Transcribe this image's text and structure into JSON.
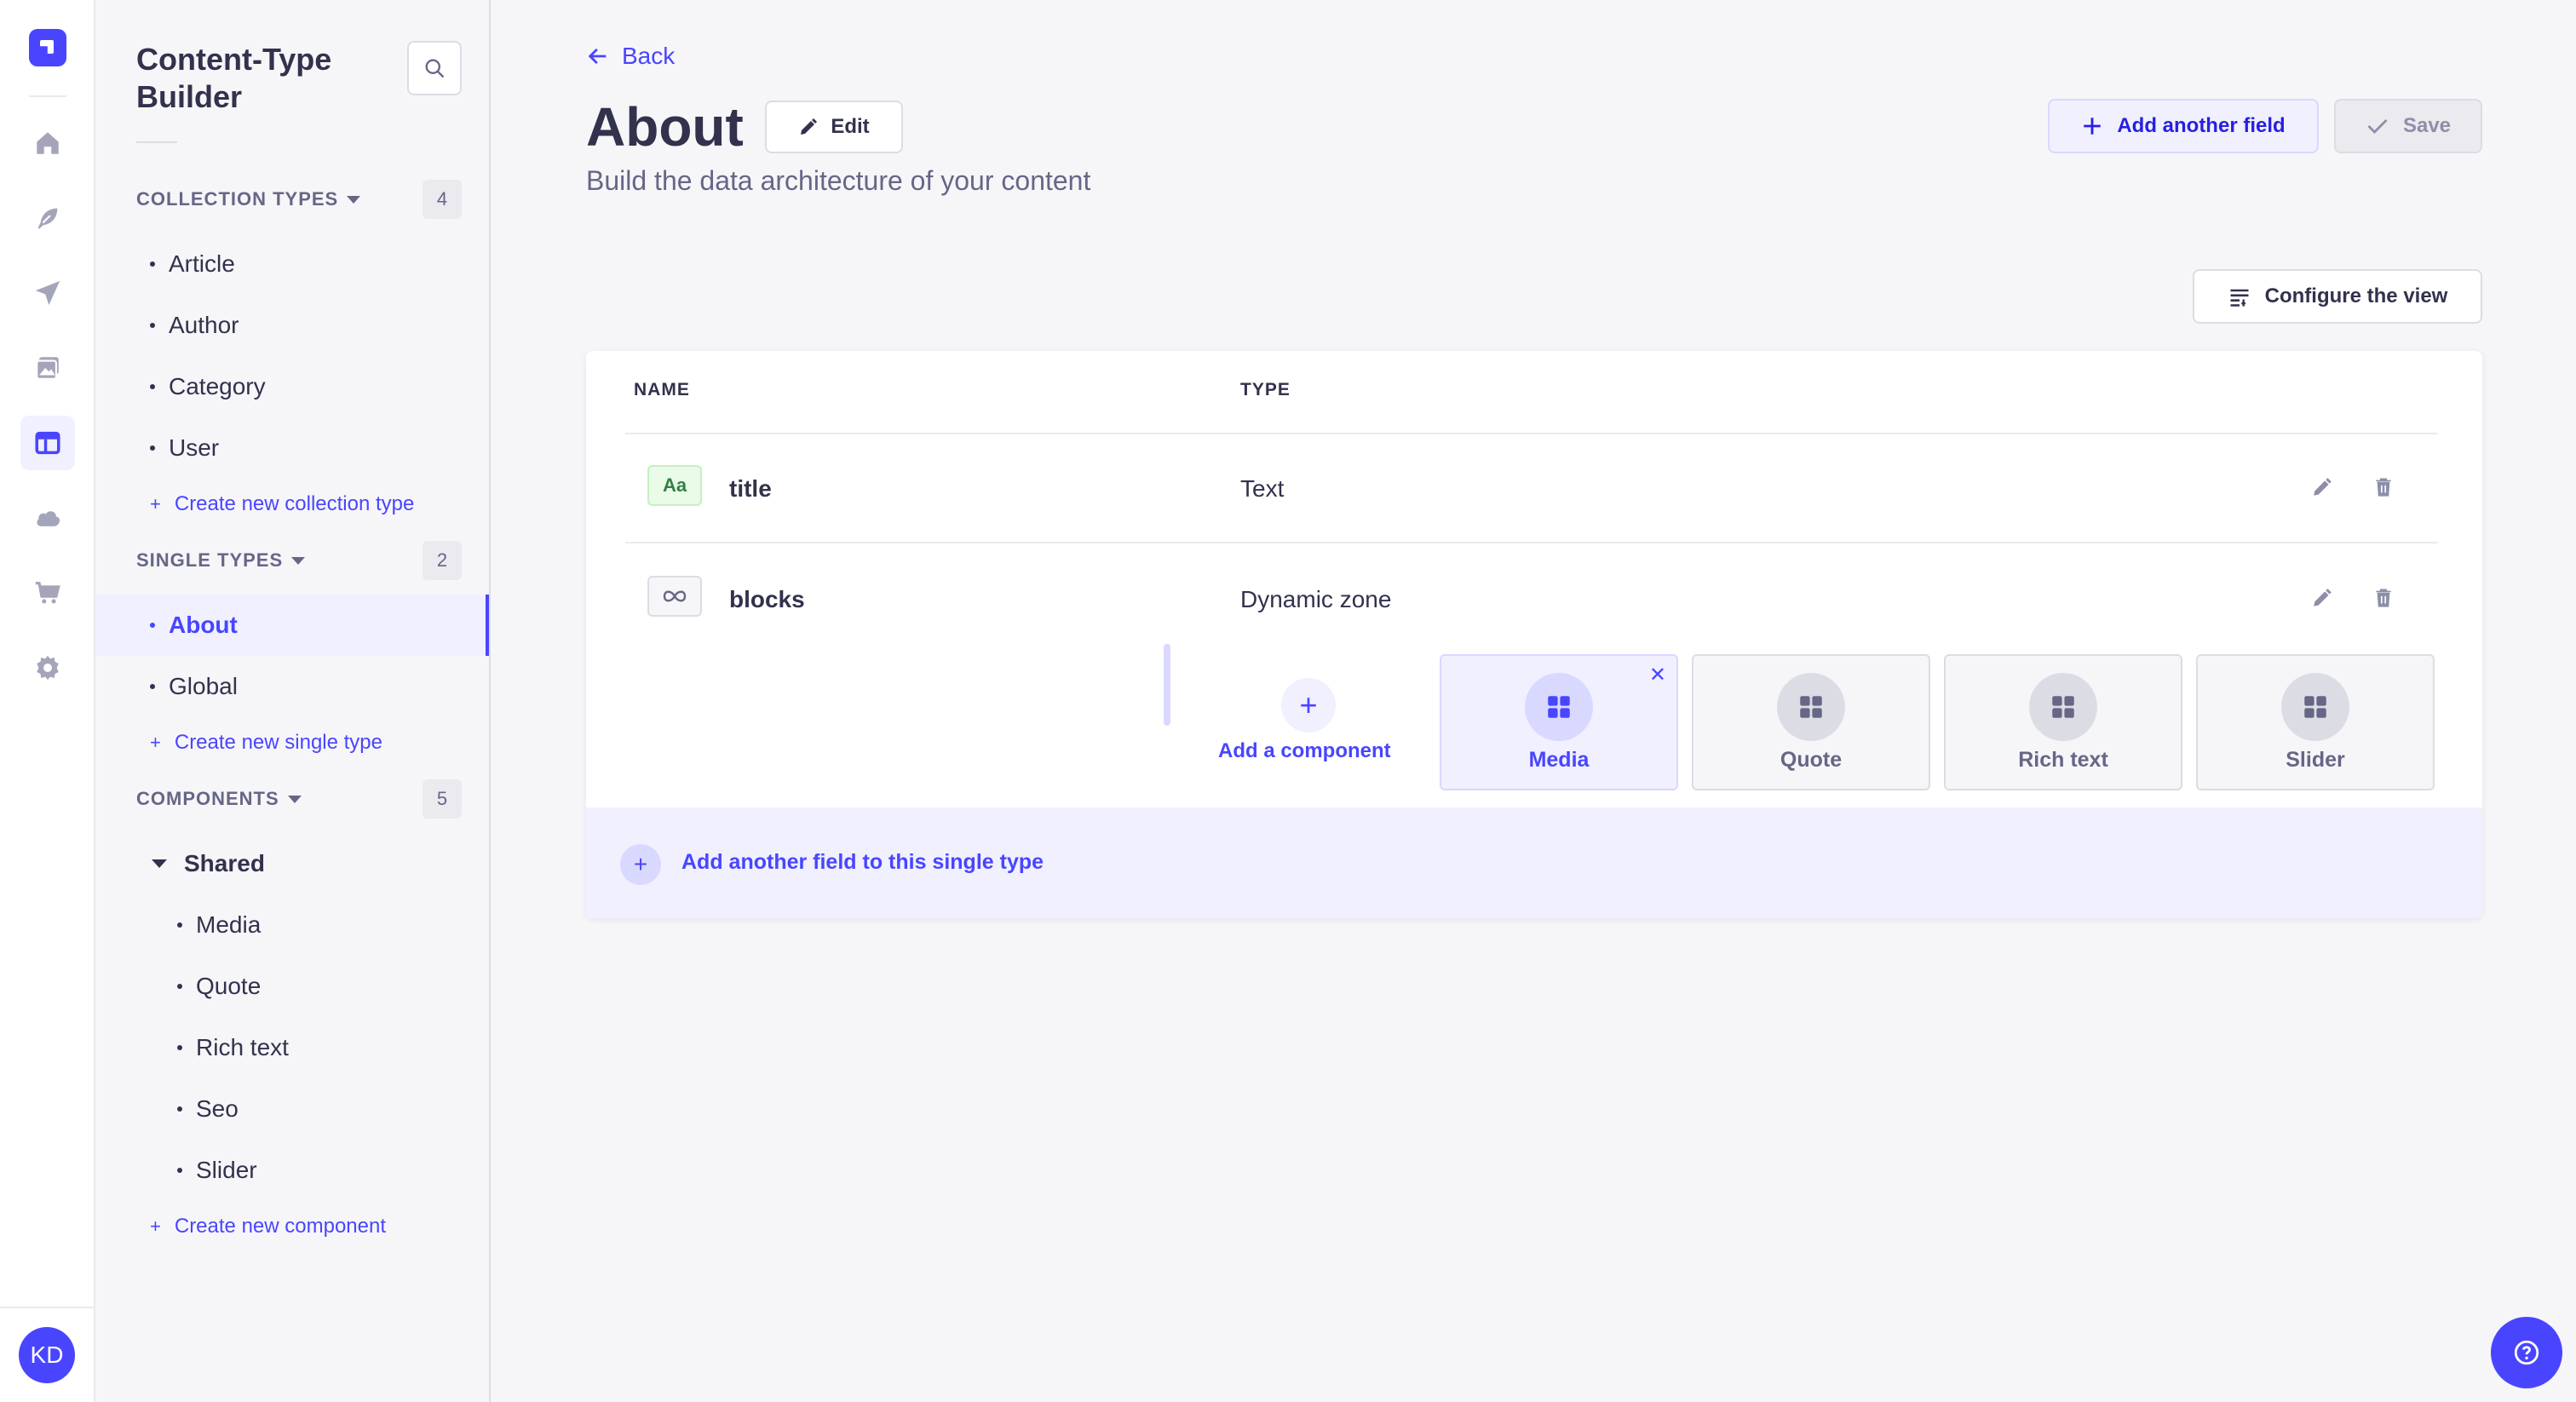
{
  "rail": {
    "icons": [
      "logo-icon",
      "home-icon",
      "feather-icon",
      "paper-plane-icon",
      "images-icon",
      "layout-icon",
      "cloud-icon",
      "cart-icon",
      "gear-icon"
    ],
    "avatar_initials": "KD",
    "accent": "#4945ff"
  },
  "subnav": {
    "title": "Content-Type Builder",
    "collection_types": {
      "label": "COLLECTION TYPES",
      "count": "4",
      "items": [
        "Article",
        "Author",
        "Category",
        "User"
      ],
      "create_label": "Create new collection type"
    },
    "single_types": {
      "label": "SINGLE TYPES",
      "count": "2",
      "items": [
        "About",
        "Global"
      ],
      "active": "About",
      "create_label": "Create new single type"
    },
    "components": {
      "label": "COMPONENTS",
      "count": "5",
      "group": "Shared",
      "items": [
        "Media",
        "Quote",
        "Rich text",
        "Seo",
        "Slider"
      ],
      "create_label": "Create new component"
    }
  },
  "header": {
    "back_label": "Back",
    "title": "About",
    "edit_label": "Edit",
    "subtitle": "Build the data architecture of your content",
    "add_field_label": "Add another field",
    "save_label": "Save",
    "configure_label": "Configure the view"
  },
  "table": {
    "columns": [
      "NAME",
      "TYPE"
    ],
    "rows": [
      {
        "icon_text": "Aa",
        "icon": "text-field-icon",
        "name": "title",
        "type": "Text"
      },
      {
        "icon_text": "",
        "icon": "infinity-icon",
        "name": "blocks",
        "type": "Dynamic zone"
      }
    ],
    "dynamic_zone": {
      "add_component_label": "Add a component",
      "components": [
        "Media",
        "Quote",
        "Rich text",
        "Slider"
      ],
      "active": "Media"
    },
    "footer_add_label": "Add another field to this single type"
  }
}
